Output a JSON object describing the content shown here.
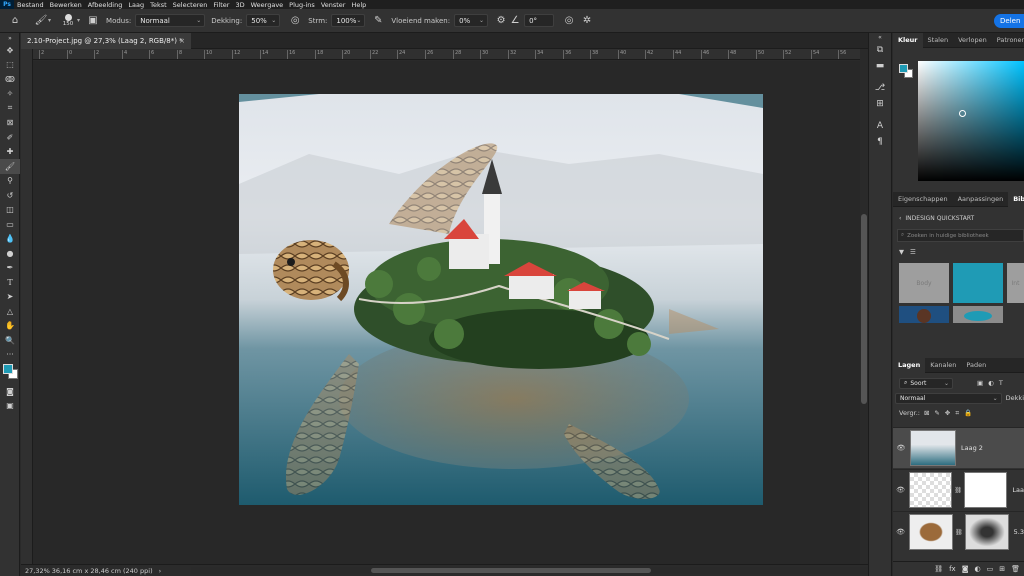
{
  "menu": {
    "app_icon": "Ps",
    "items": [
      "Bestand",
      "Bewerken",
      "Afbeelding",
      "Laag",
      "Tekst",
      "Selecteren",
      "Filter",
      "3D",
      "Weergave",
      "Plug-ins",
      "Venster",
      "Help"
    ]
  },
  "options": {
    "brush_size": "150",
    "mode_label": "Modus:",
    "mode_value": "Normaal",
    "opacity_label": "Dekking:",
    "opacity_value": "50%",
    "flow_label": "Strm:",
    "flow_value": "100%",
    "smoothing_label": "Vloeiend maken:",
    "smoothing_value": "0%",
    "angle_value": "0°",
    "share_label": "Delen"
  },
  "document": {
    "tab_title": "2.10-Project.jpg @ 27,3% (Laag 2, RGB/8*) *",
    "close": "×"
  },
  "status": {
    "zoom": "27,32%",
    "info": "36,16 cm x 28,46 cm (240 ppi)",
    "arrow": "›"
  },
  "ruler_ticks": [
    "2",
    "0",
    "2",
    "4",
    "6",
    "8",
    "10",
    "12",
    "14",
    "16",
    "18",
    "20",
    "22",
    "24",
    "26",
    "28",
    "30",
    "32",
    "34",
    "36",
    "38",
    "40",
    "42",
    "44",
    "46",
    "48",
    "50",
    "52",
    "54",
    "56"
  ],
  "panels": {
    "color_tabs": [
      "Kleur",
      "Stalen",
      "Verlopen",
      "Patronen"
    ],
    "props_tabs": [
      "Eigenschappen",
      "Aanpassingen",
      "Biblio"
    ],
    "library": {
      "back_label": "INDESIGN QUICKSTART",
      "search_placeholder": "Zoeken in huidige bibliotheek",
      "tile_text": "Body",
      "tile_text2": "Int"
    },
    "layers_tabs": [
      "Lagen",
      "Kanalen",
      "Paden"
    ],
    "layers_filter": "Soort",
    "blend_mode": "Normaal",
    "opacity_short": "Dekki",
    "lock_label": "Vergr.:",
    "layers": [
      {
        "name": "Laag 2"
      },
      {
        "name": "Laa"
      },
      {
        "name": "5.3"
      }
    ]
  },
  "colors": {
    "accent": "#1473e6",
    "foreground": "#1f9bb5",
    "background": "#ffffff"
  }
}
